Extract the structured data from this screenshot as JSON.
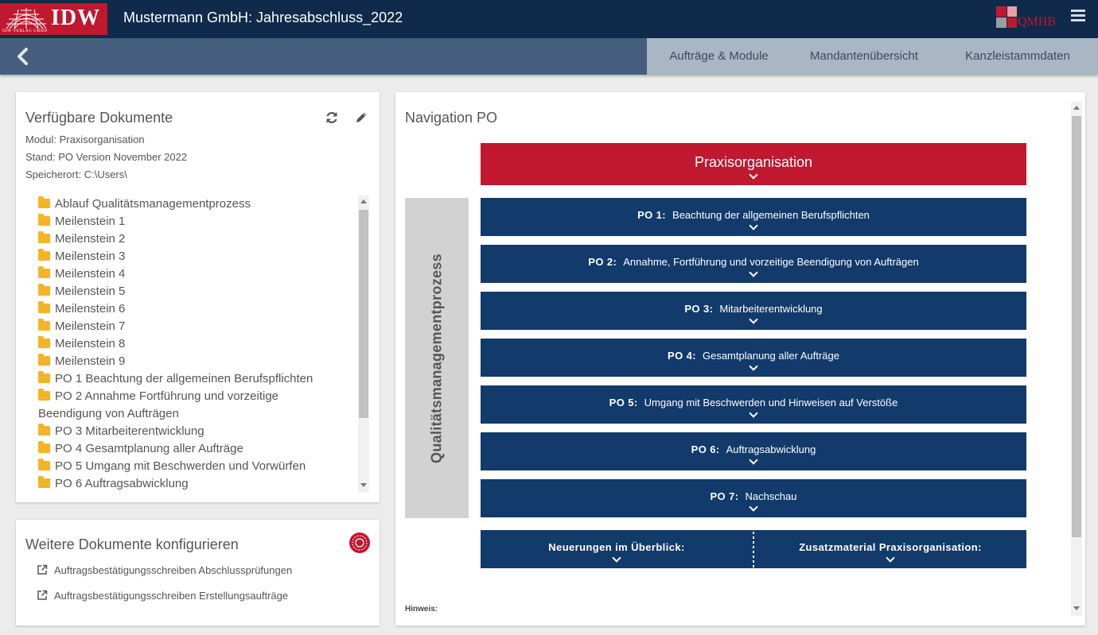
{
  "header": {
    "logo_text": "IDW",
    "logo_subtext": "IDW VERLAG GMBH",
    "title": "Mustermann GmbH: Jahresabschluss_2022",
    "brand_text": "QMHB"
  },
  "nav": {
    "tabs": [
      {
        "label": "Aufträge & Module"
      },
      {
        "label": "Mandantenübersicht"
      },
      {
        "label": "Kanzleistammdaten"
      }
    ]
  },
  "docs_panel": {
    "title": "Verfügbare Dokumente",
    "modul": "Modul: Praxisorganisation",
    "stand": "Stand: PO Version November 2022",
    "speicherort": "Speicherort: C:\\Users\\",
    "items": [
      "Ablauf Qualitätsmanagementprozess",
      "Meilenstein 1",
      "Meilenstein 2",
      "Meilenstein 3",
      "Meilenstein 4",
      "Meilenstein 5",
      "Meilenstein 6",
      "Meilenstein 7",
      "Meilenstein 8",
      "Meilenstein 9",
      "PO 1 Beachtung der allgemeinen Berufspflichten",
      "PO 2 Annahme Fortführung und vorzeitige",
      "Beendigung von Aufträgen",
      "PO 3 Mitarbeiterentwicklung",
      "PO 4 Gesamtplanung aller Aufträge",
      "PO 5 Umgang mit Beschwerden und Vorwürfen",
      "PO 6 Auftragsabwicklung"
    ]
  },
  "config_panel": {
    "title": "Weitere Dokumente konfigurieren",
    "links": [
      "Auftragsbestätigungsschreiben Abschlussprüfungen",
      "Auftragsbestätigungsschreiben Erstellungsaufträge"
    ]
  },
  "nav_panel": {
    "title": "Navigation PO",
    "side_label": "Qualitätsmanagementprozess",
    "header_label": "Praxisorganisation",
    "rows": [
      {
        "num": "PO 1:",
        "text": "Beachtung der allgemeinen Berufspflichten"
      },
      {
        "num": "PO 2:",
        "text": "Annahme, Fortführung und vorzeitige Beendigung von Aufträgen"
      },
      {
        "num": "PO 3:",
        "text": "Mitarbeiterentwicklung"
      },
      {
        "num": "PO 4:",
        "text": "Gesamtplanung aller Aufträge"
      },
      {
        "num": "PO 5:",
        "text": "Umgang mit Beschwerden und Hinweisen auf Verstöße"
      },
      {
        "num": "PO 6:",
        "text": "Auftragsabwicklung"
      },
      {
        "num": "PO 7:",
        "text": "Nachschau"
      }
    ],
    "split_left": "Neuerungen im Überblick:",
    "split_right": "Zusatzmaterial Praxisorganisation:",
    "hint": "Hinweis:"
  },
  "colors": {
    "header_bg": "#0f2a4a",
    "nav_bg": "#455e7e",
    "tabs_bg": "#a9b6c4",
    "accent_red": "#c0182f",
    "row_blue": "#123a6b",
    "folder": "#f5b427"
  }
}
